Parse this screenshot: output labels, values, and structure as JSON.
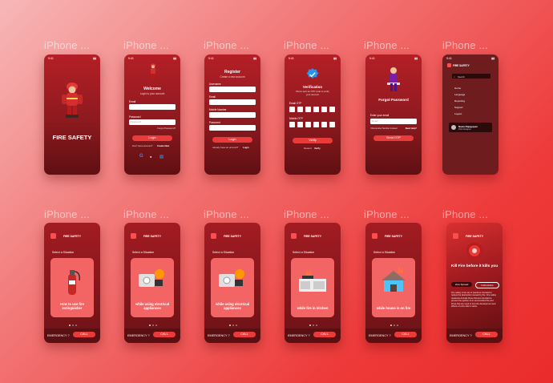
{
  "frame_label": "iPhone ...",
  "status_time": "9:41",
  "splash": {
    "title": "FIRE SAFETY"
  },
  "login": {
    "title": "Welcome",
    "subtitle": "Login to your account",
    "email_label": "Email",
    "password_label": "Password",
    "password_placeholder": "Password",
    "forgot": "Forgot Password?",
    "button": "Login",
    "no_account": "Don't have account?",
    "create": "Create New"
  },
  "register": {
    "title": "Register",
    "subtitle": "Create a new account",
    "fields": [
      "Username",
      "Email",
      "Mobile Number",
      "Password"
    ],
    "button": "Login",
    "have_account": "Already have an account?",
    "login_link": "Login"
  },
  "verify": {
    "title": "Verification",
    "subtitle": "We've sent an OTP code to verify your account",
    "email_otp": "Email OTP",
    "mobile_otp": "Mobile OTP",
    "button": "Verify",
    "resend": "Resend",
    "resend_link": "Verify"
  },
  "forgot": {
    "title": "Forgot Password",
    "email_label": "Enter your email",
    "email_placeholder": "Email",
    "remember": "I Remember Number Instead",
    "need_help": "Need Help?",
    "button": "Send OTP"
  },
  "menu": {
    "title": "FIRE SAFETY",
    "search": "Search",
    "items": [
      "Home",
      "Language",
      "Reporting",
      "Support",
      "Logout"
    ],
    "profile_name": "Nazia Rajagopan",
    "profile_sub": "Web Designer"
  },
  "situation": {
    "header": "FIRE SAFETY",
    "prompt": "Select a Situation",
    "cards": [
      "How to use fire extinguisher",
      "while using electrical appliances",
      "while using electrical appliances",
      "while fire in kitchen",
      "while house is on fire"
    ],
    "emergency": "EMERGENCY ?",
    "call": "CALL"
  },
  "alarm": {
    "header": "FIRE SAFETY",
    "title": "Kill Fire before it kills you",
    "tab_active": "How Spread",
    "tab_other": "Instructions",
    "body": "Fire safety is the set of practices intended to reduce the destruction caused by fire. Fire safety measures include those that are intended to prevent the ignition of an uncontrolled fire and those that are used to limit the development and effects of a fire after it starts.",
    "emergency": "EMERGENCY ?",
    "call": "CALL"
  }
}
